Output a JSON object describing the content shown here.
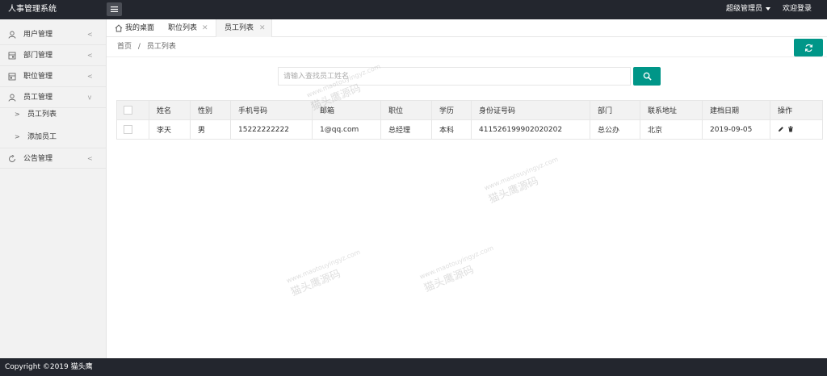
{
  "header": {
    "app_title": "人事管理系统",
    "user_name": "超级管理员",
    "welcome": "欢迎登录"
  },
  "sidebar": {
    "items": [
      {
        "label": "用户管理",
        "icon": "user-icon"
      },
      {
        "label": "部门管理",
        "icon": "department-icon"
      },
      {
        "label": "职位管理",
        "icon": "position-icon"
      },
      {
        "label": "员工管理",
        "icon": "employee-icon"
      },
      {
        "label": "公告管理",
        "icon": "refresh-icon"
      }
    ],
    "sub_items": [
      {
        "label": "员工列表"
      },
      {
        "label": "添加员工"
      }
    ]
  },
  "tabs": [
    {
      "label": "我的桌面"
    },
    {
      "label": "职位列表"
    },
    {
      "label": "员工列表"
    }
  ],
  "breadcrumb": {
    "home": "首页",
    "separator": "/",
    "current": "员工列表"
  },
  "search": {
    "placeholder": "请输入查找员工姓名"
  },
  "table": {
    "headers": [
      "姓名",
      "性别",
      "手机号码",
      "邮箱",
      "职位",
      "学历",
      "身份证号码",
      "部门",
      "联系地址",
      "建档日期",
      "操作"
    ],
    "rows": [
      [
        "李天",
        "男",
        "15222222222",
        "1@qq.com",
        "总经理",
        "本科",
        "411526199902020202",
        "总公办",
        "北京",
        "2019-09-05"
      ]
    ]
  },
  "footer": {
    "copyright": "Copyright ©2019 猫头鹰"
  },
  "watermark": {
    "text": "猫头鹰源码",
    "url": "www.maotouyingyz.com"
  },
  "colors": {
    "header_bg": "#23262e",
    "accent": "#009688",
    "sidebar_bg": "#f2f2f2"
  }
}
